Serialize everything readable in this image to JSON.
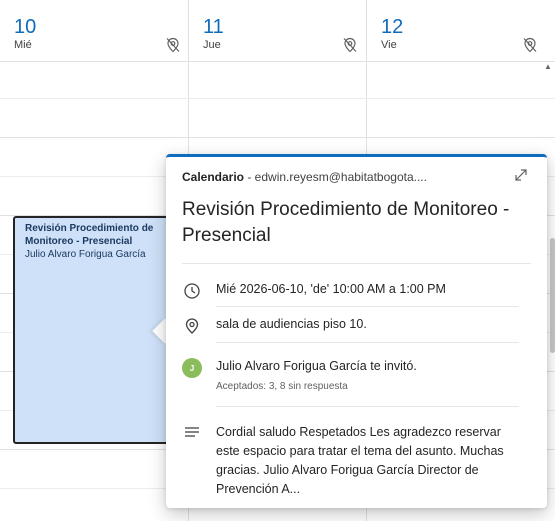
{
  "days": [
    {
      "num": "10",
      "name": "Mié"
    },
    {
      "num": "11",
      "name": "Jue"
    },
    {
      "num": "12",
      "name": "Vie"
    }
  ],
  "event": {
    "title": "Revisión Procedimiento de Monitoreo - Presencial",
    "organizer": "Julio Alvaro Forigua García"
  },
  "popover": {
    "calendar_label": "Calendario",
    "calendar_account": " - edwin.reyesm@habitatbogota....",
    "title": "Revisión Procedimiento de Monitoreo - Presencial",
    "datetime": "Mié 2026-06-10, 'de' 10:00 AM a 1:00 PM",
    "location": "sala de audiencias piso 10.",
    "avatar_initial": "J",
    "invite_text": "Julio Alvaro Forigua García te invitó.",
    "responses": "Aceptados: 3, 8 sin respuesta",
    "description": "Cordial saludo Respetados Les agradezco reservar este espacio para tratar el tema del asunto. Muchas gracias. Julio Alvaro Forigua García Director de Prevención A..."
  },
  "colors": {
    "accent": "#0f6cbd",
    "event_bg": "#cfe1f8",
    "avatar": "#8cbd5c"
  },
  "icons": [
    "no-location-icon",
    "expand-icon",
    "clock-icon",
    "location-icon",
    "description-icon"
  ]
}
